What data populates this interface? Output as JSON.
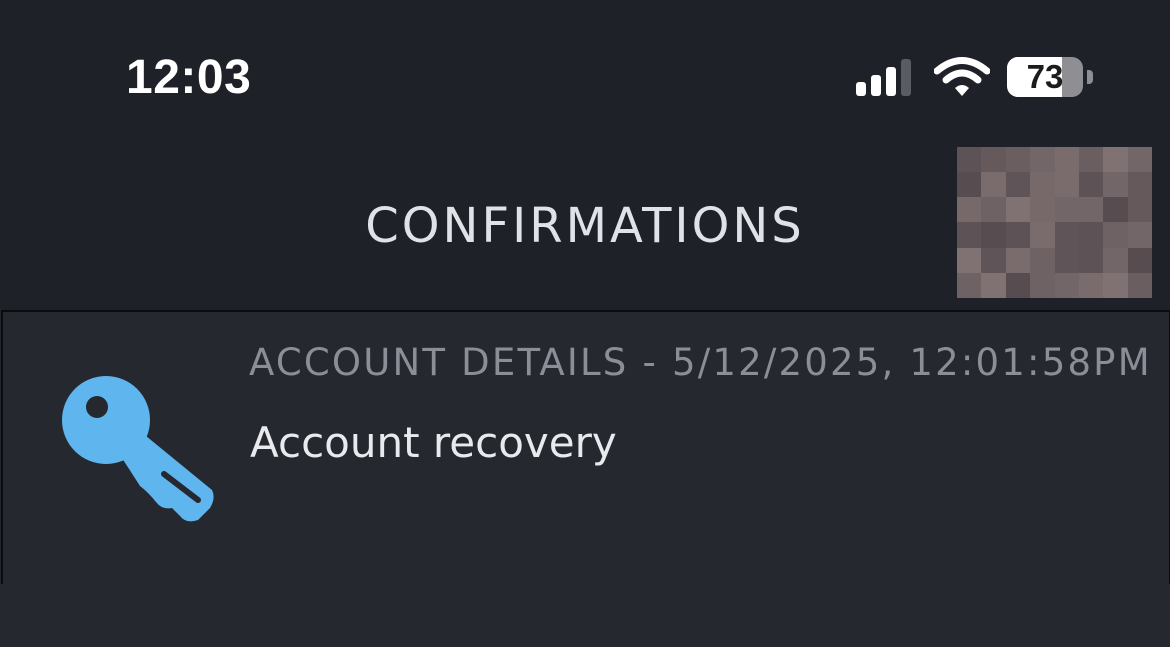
{
  "status_bar": {
    "time": "12:03",
    "battery_level": "73",
    "battery_percent": 73,
    "signal_bars_active": 3,
    "signal_bars_total": 4
  },
  "header": {
    "title": "CONFIRMATIONS"
  },
  "confirmations": [
    {
      "icon": "key-icon",
      "meta": "ACCOUNT DETAILS - 5/12/2025, 12:01:58PM",
      "description": "Account recovery"
    }
  ],
  "colors": {
    "background": "#22242b",
    "header_background": "#1f2128",
    "item_background": "#262830",
    "key_icon": "#5fb6ee",
    "title_text": "#dfe3e8",
    "meta_text": "#8b8e96",
    "description_text": "#e8eaee"
  }
}
